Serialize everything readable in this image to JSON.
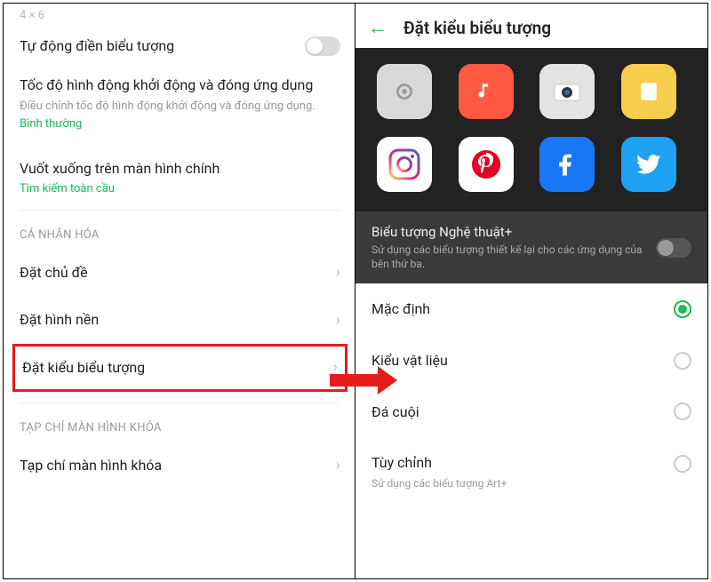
{
  "left": {
    "crumb": "4 × 6",
    "auto_fill": "Tự động điền biểu tượng",
    "anim_title": "Tốc độ hình động khởi động và đóng ứng dụng",
    "anim_sub": "Điều chỉnh tốc độ hình động khởi động và đóng ứng dụng.",
    "anim_val": "Bình thường",
    "swipe_title": "Vuốt xuống trên màn hình chính",
    "swipe_val": "Tìm kiếm toàn cầu",
    "sec_personal": "CÁ NHÂN HÓA",
    "set_theme": "Đặt chủ đề",
    "set_wall": "Đặt hình nền",
    "set_icon": "Đặt kiểu biểu tượng",
    "sec_lock": "TẠP CHÍ MÀN HÌNH KHÓA",
    "lock_mag": "Tạp chí màn hình khóa"
  },
  "right": {
    "header": "Đặt kiểu biểu tượng",
    "art_title": "Biểu tượng Nghệ thuật+",
    "art_sub": "Sử dụng các biểu tượng thiết kế lại cho các ứng dụng của bên thứ ba.",
    "opts": {
      "default": "Mặc định",
      "material": "Kiểu vật liệu",
      "pebble": "Đá cuội",
      "custom": "Tùy chỉnh",
      "custom_sub": "Sử dụng các biểu tượng Art+"
    }
  }
}
